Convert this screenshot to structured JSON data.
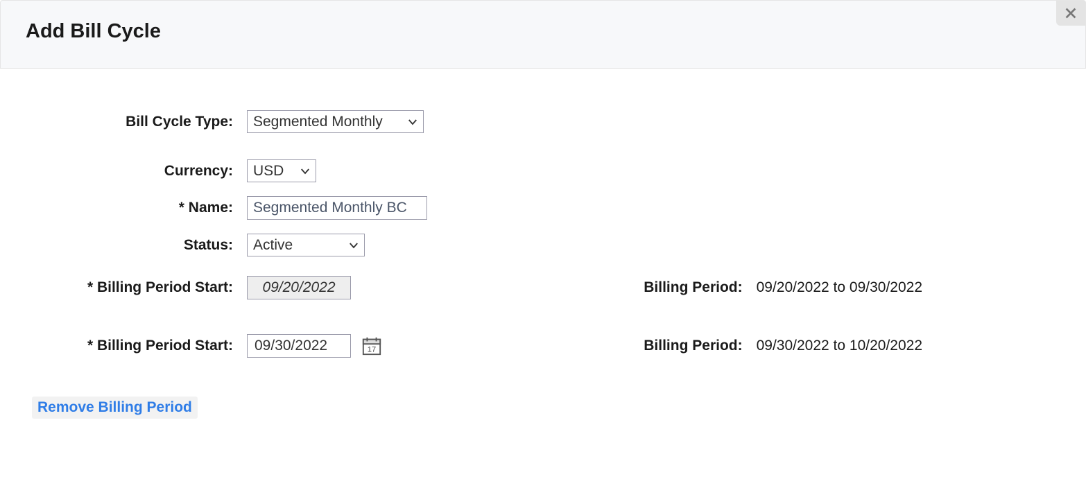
{
  "header": {
    "title": "Add Bill Cycle"
  },
  "form": {
    "billCycleType": {
      "label": "Bill Cycle Type:",
      "value": "Segmented Monthly"
    },
    "currency": {
      "label": "Currency:",
      "value": "USD"
    },
    "name": {
      "label": "* Name:",
      "value": "Segmented Monthly BC"
    },
    "status": {
      "label": "Status:",
      "value": "Active"
    },
    "period1": {
      "label": "* Billing Period Start:",
      "value": "09/20/2022",
      "summaryLabel": "Billing Period:",
      "summaryValue": "09/20/2022 to 09/30/2022"
    },
    "period2": {
      "label": "* Billing Period Start:",
      "value": "09/30/2022",
      "summaryLabel": "Billing Period:",
      "summaryValue": "09/30/2022 to 10/20/2022"
    }
  },
  "actions": {
    "removeLink": "Remove Billing Period"
  }
}
